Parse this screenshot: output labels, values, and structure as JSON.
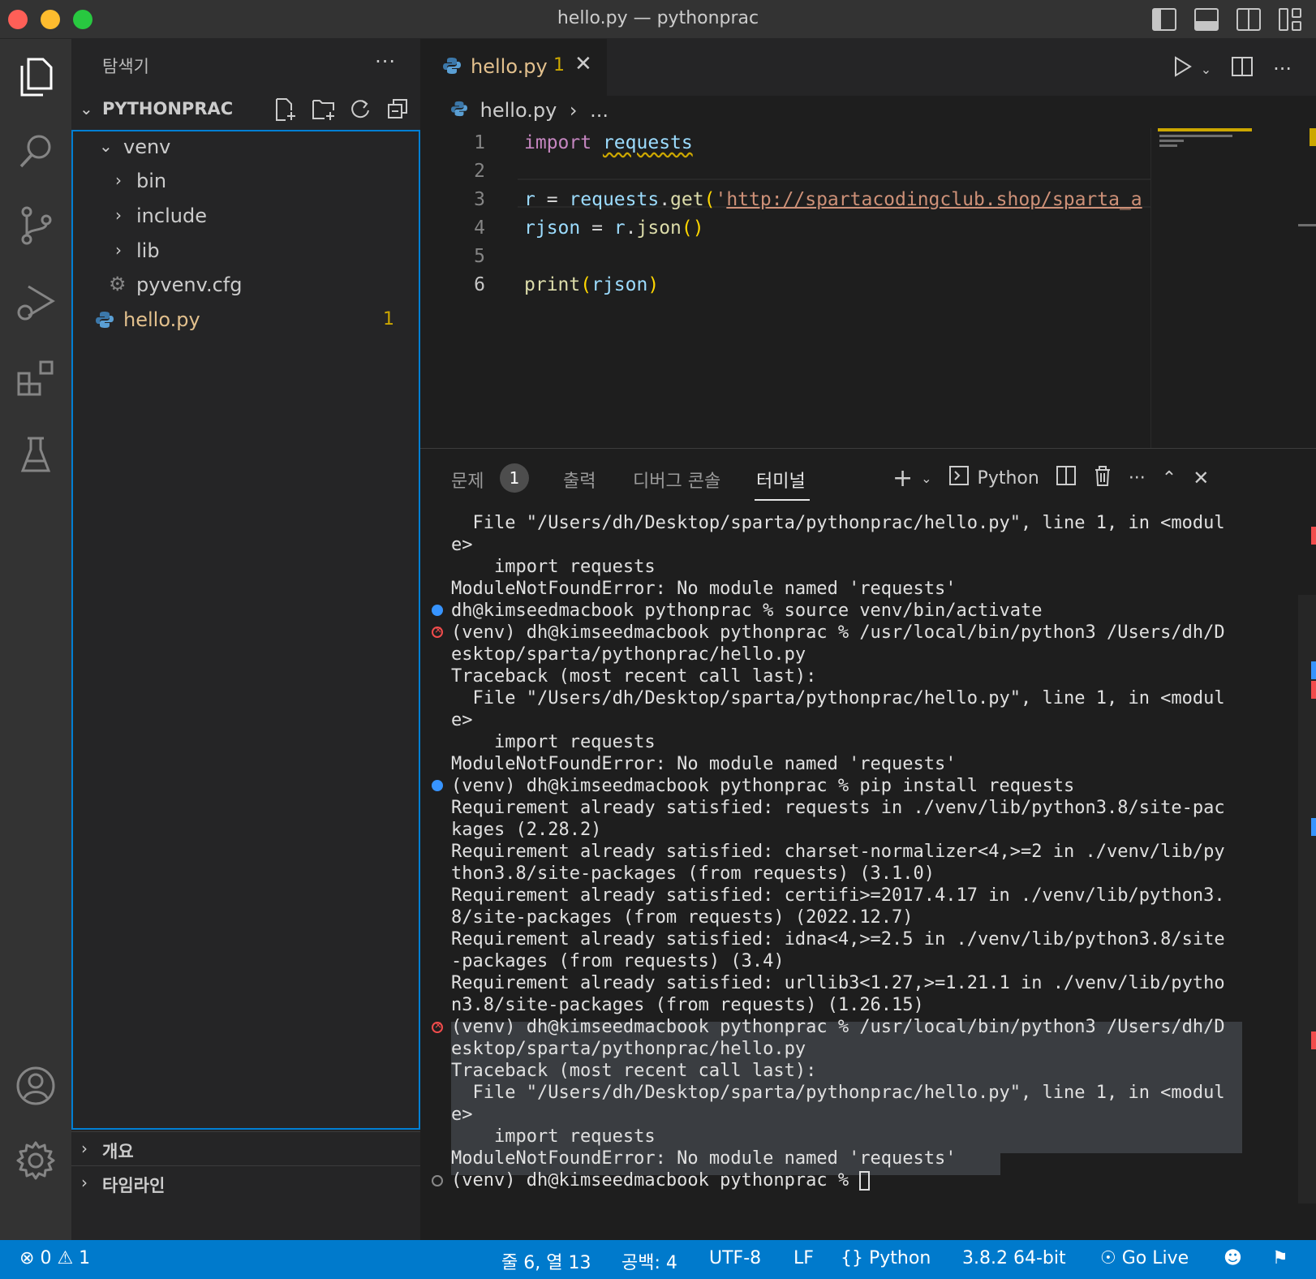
{
  "window": {
    "title": "hello.py — pythonprac"
  },
  "sidebar": {
    "header": "탐색기",
    "more": "···",
    "project": "PYTHONPRAC",
    "tree": [
      {
        "label": "venv"
      },
      {
        "label": "bin"
      },
      {
        "label": "include"
      },
      {
        "label": "lib"
      },
      {
        "label": "pyvenv.cfg"
      },
      {
        "label": "hello.py",
        "badge": "1"
      }
    ],
    "sections": [
      "개요",
      "타임라인"
    ]
  },
  "editor": {
    "tab": {
      "name": "hello.py",
      "count": "1"
    },
    "breadcrumb": {
      "file": "hello.py",
      "rest": "..."
    },
    "line_numbers": [
      "1",
      "2",
      "3",
      "4",
      "5",
      "6"
    ],
    "code": {
      "l1_kw": "import",
      "l1_mod": "requests",
      "l3_a": "r",
      "l3_b": " = ",
      "l3_c": "requests",
      "l3_d": ".",
      "l3_e": "get",
      "l3_f": "(",
      "l3_g": "'",
      "l3_h": "http://spartacodingclub.shop/sparta_a",
      "l4_a": "rjson",
      "l4_b": " = ",
      "l4_c": "r",
      "l4_d": ".",
      "l4_e": "json",
      "l4_f": "()",
      "l6_a": "print",
      "l6_b": "(",
      "l6_c": "rjson",
      "l6_d": ")"
    }
  },
  "panel": {
    "tabs": [
      "문제",
      "출력",
      "디버그 콘솔",
      "터미널"
    ],
    "problem_count": "1",
    "terminal_name": "Python",
    "terminal_lines": [
      "  File \"/Users/dh/Desktop/sparta/pythonprac/hello.py\", line 1, in <modul",
      "e>",
      "    import requests",
      "ModuleNotFoundError: No module named 'requests'",
      "dh@kimseedmacbook pythonprac % source venv/bin/activate",
      "(venv) dh@kimseedmacbook pythonprac % /usr/local/bin/python3 /Users/dh/D",
      "esktop/sparta/pythonprac/hello.py",
      "Traceback (most recent call last):",
      "  File \"/Users/dh/Desktop/sparta/pythonprac/hello.py\", line 1, in <modul",
      "e>",
      "    import requests",
      "ModuleNotFoundError: No module named 'requests'",
      "(venv) dh@kimseedmacbook pythonprac % pip install requests",
      "Requirement already satisfied: requests in ./venv/lib/python3.8/site-pac",
      "kages (2.28.2)",
      "Requirement already satisfied: charset-normalizer<4,>=2 in ./venv/lib/py",
      "thon3.8/site-packages (from requests) (3.1.0)",
      "Requirement already satisfied: certifi>=2017.4.17 in ./venv/lib/python3.",
      "8/site-packages (from requests) (2022.12.7)",
      "Requirement already satisfied: idna<4,>=2.5 in ./venv/lib/python3.8/site",
      "-packages (from requests) (3.4)",
      "Requirement already satisfied: urllib3<1.27,>=1.21.1 in ./venv/lib/pytho",
      "n3.8/site-packages (from requests) (1.26.15)",
      "(venv) dh@kimseedmacbook pythonprac % /usr/local/bin/python3 /Users/dh/D",
      "esktop/sparta/pythonprac/hello.py",
      "Traceback (most recent call last):",
      "  File \"/Users/dh/Desktop/sparta/pythonprac/hello.py\", line 1, in <modul",
      "e>",
      "    import requests",
      "ModuleNotFoundError: No module named 'requests'",
      "(venv) dh@kimseedmacbook pythonprac % "
    ]
  },
  "statusbar": {
    "errors": "0",
    "warnings": "1",
    "position": "줄 6, 열 13",
    "spaces": "공백: 4",
    "encoding": "UTF-8",
    "eol": "LF",
    "language": "Python",
    "interpreter": "3.8.2 64-bit",
    "golive": "Go Live"
  },
  "colors": {
    "accent": "#007acc",
    "status_bar": "#007acc",
    "modified_file": "#e2c08d",
    "warning": "#cca700",
    "error": "#f14c4c",
    "info_dot": "#3794ff"
  }
}
